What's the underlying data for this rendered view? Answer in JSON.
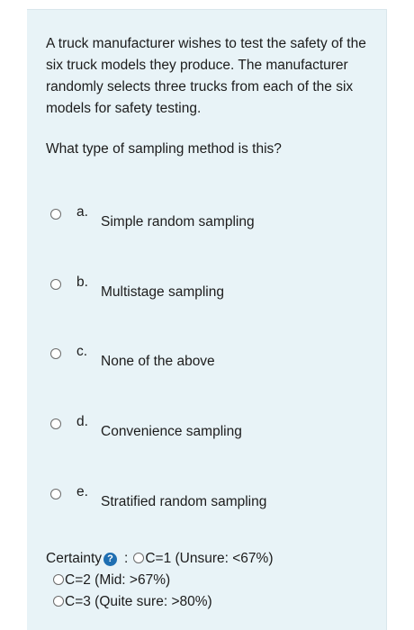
{
  "question": {
    "paragraph1": "A truck manufacturer wishes to test the safety of the six truck models they produce. The manufacturer randomly selects three trucks from each of the six models for safety testing.",
    "paragraph2": "What type of sampling method is this?"
  },
  "options": [
    {
      "letter": "a.",
      "text": "Simple random sampling"
    },
    {
      "letter": "b.",
      "text": "Multistage sampling"
    },
    {
      "letter": "c.",
      "text": "None of the above"
    },
    {
      "letter": "d.",
      "text": "Convenience sampling"
    },
    {
      "letter": "e.",
      "text": "Stratified random sampling"
    }
  ],
  "certainty": {
    "label": "Certainty",
    "help_icon": "?",
    "colon": ":",
    "choices": [
      "C=1 (Unsure: <67%)",
      "C=2 (Mid: >67%)",
      "C=3 (Quite sure: >80%)"
    ]
  },
  "colors": {
    "panel_background": "#e8f3f7",
    "help_icon": "#1f6fb2"
  }
}
